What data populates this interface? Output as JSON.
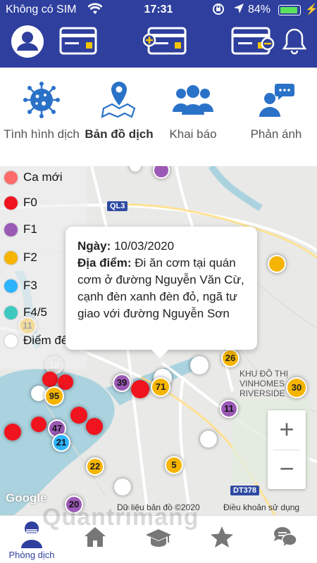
{
  "status_bar": {
    "carrier": "Không có SIM",
    "time": "17:31",
    "battery": "84%",
    "battery_level": 0.84
  },
  "header": {
    "icons": [
      "profile-icon",
      "card-icon",
      "add-card-icon",
      "remove-card-icon",
      "bell-icon"
    ]
  },
  "menu": {
    "items": [
      {
        "label": "Tình hình dịch",
        "icon": "virus-icon",
        "active": false
      },
      {
        "label": "Bản đồ dịch",
        "icon": "map-pin-icon",
        "active": true
      },
      {
        "label": "Khai báo",
        "icon": "people-icon",
        "active": false
      },
      {
        "label": "Phản ánh",
        "icon": "chat-person-icon",
        "active": false
      }
    ]
  },
  "map": {
    "legend": [
      {
        "label": "Ca mới",
        "color": "#ff6b6b"
      },
      {
        "label": "F0",
        "color": "#f0141e"
      },
      {
        "label": "F1",
        "color": "#9b59b6"
      },
      {
        "label": "F2",
        "color": "#f5b400"
      },
      {
        "label": "F3",
        "color": "#2eb4ff"
      },
      {
        "label": "F4/5",
        "color": "#3ec9c0"
      },
      {
        "label": "Điểm đến",
        "color": "#ffffff"
      }
    ],
    "info_window": {
      "date_label": "Ngày:",
      "date_value": "10/03/2020",
      "place_label": "Địa điểm:",
      "place_value": "Đi ăn cơm tại quán cơm ở đường Nguyễn Văn Cừ, cạnh đèn xanh đèn đỏ, ngã tư giao với đường Nguyễn Sơn"
    },
    "place_labels": {
      "district": "KHU ĐÔ THỊ VINHOMES RIVERSIDE",
      "district_line1": "KHU ĐÔ THỊ",
      "district_line2": "VINHOMES",
      "district_line3": "RIVERSIDE",
      "road_ql3": "QL3",
      "road_dt378": "DT378",
      "attribution": "Dữ liệu bản đồ ©2020",
      "terms": "Điều khoản sử dụng",
      "google": "Google"
    },
    "cluster_numbers": [
      "11",
      "18",
      "39",
      "71",
      "26",
      "30",
      "95",
      "47",
      "21",
      "11",
      "22",
      "5",
      "20"
    ],
    "zoom_in": "+",
    "zoom_out": "−"
  },
  "tabs": {
    "items": [
      {
        "label": "Phòng dịch",
        "icon": "mask-person-icon"
      },
      {
        "label": "",
        "icon": "home-icon"
      },
      {
        "label": "",
        "icon": "graduation-cap-icon"
      },
      {
        "label": "",
        "icon": "star-icon"
      },
      {
        "label": "",
        "icon": "chat-bubbles-icon"
      }
    ]
  },
  "watermark": "Quantrimang"
}
